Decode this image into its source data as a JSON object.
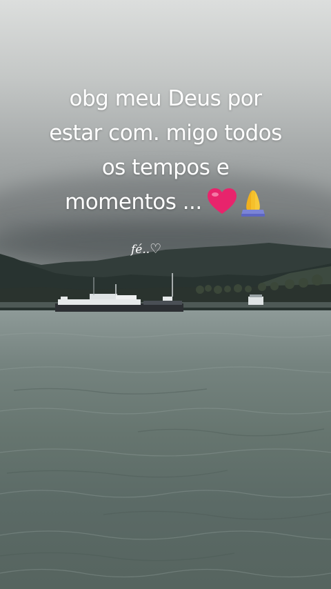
{
  "story": {
    "caption_lines": [
      "obg meu Deus por",
      "estar com. migo todos",
      "os tempos e",
      "momentos ..."
    ],
    "emojis": [
      "pink-heart-icon",
      "praying-hands-icon"
    ],
    "signature": "fé..",
    "signature_symbol": "♡"
  },
  "colors": {
    "sky": "#c9cccb",
    "mountains": "#2f3a37",
    "water": "#66756f",
    "heart": "#e8246c",
    "hands": "#f5c02b",
    "text": "#ffffff"
  }
}
